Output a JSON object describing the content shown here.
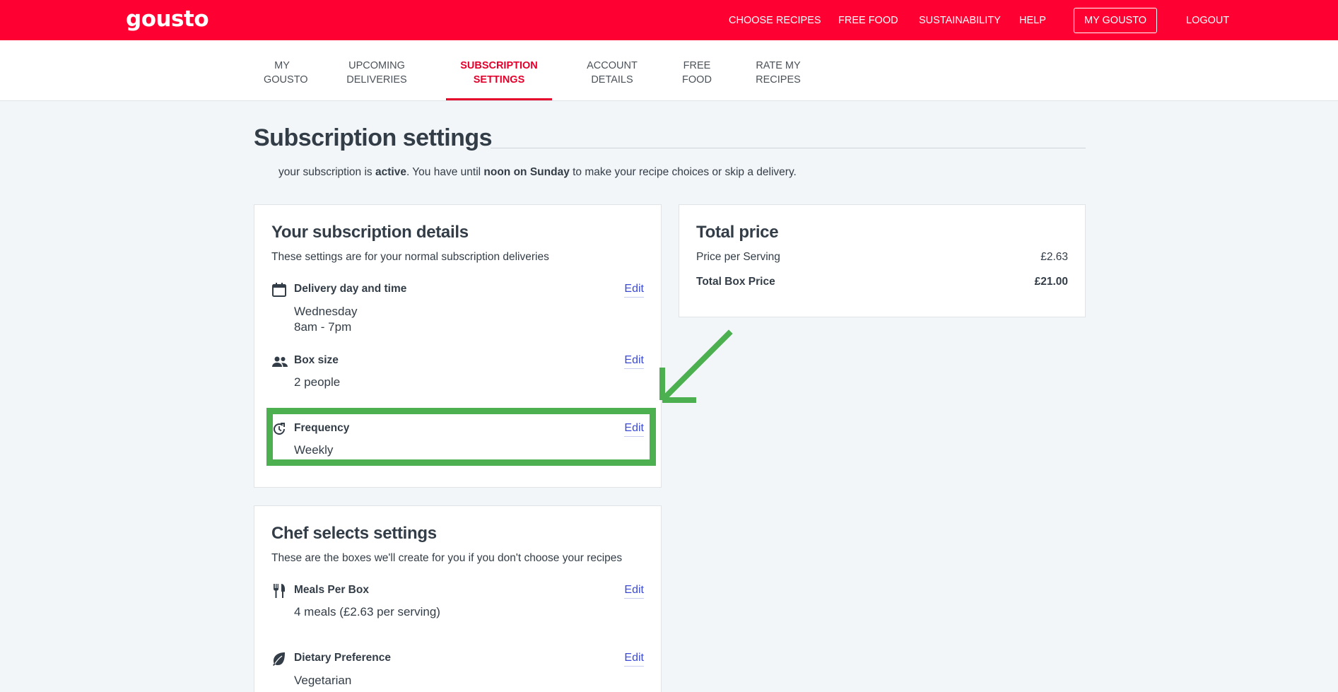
{
  "brand": {
    "logo": "gousto",
    "accent_color": "#ff0032"
  },
  "topnav": {
    "items": [
      "CHOOSE RECIPES",
      "FREE FOOD",
      "SUSTAINABILITY",
      "HELP"
    ],
    "my_gousto": "MY GOUSTO",
    "logout": "LOGOUT"
  },
  "subnav": {
    "tabs": [
      {
        "line1": "MY",
        "line2": "GOUSTO"
      },
      {
        "line1": "UPCOMING",
        "line2": "DELIVERIES"
      },
      {
        "line1": "SUBSCRIPTION",
        "line2": "SETTINGS"
      },
      {
        "line1": "ACCOUNT",
        "line2": "DETAILS"
      },
      {
        "line1": "FREE",
        "line2": "FOOD"
      },
      {
        "line1": "RATE MY",
        "line2": "RECIPES"
      }
    ],
    "active_tab": "SUBSCRIPTION SETTINGS"
  },
  "page": {
    "title": "Subscription settings",
    "status": {
      "prefix": "your subscription is ",
      "state": "active",
      "middle": ". You have until ",
      "deadline": "noon on Sunday",
      "suffix": " to make your recipe choices or skip a delivery."
    }
  },
  "subscription_details": {
    "title": "Your subscription details",
    "subtitle": "These settings are for your normal subscription deliveries",
    "delivery": {
      "label": "Delivery day and time",
      "day": "Wednesday",
      "time": "8am - 7pm",
      "edit": "Edit",
      "icon": "calendar-icon"
    },
    "box_size": {
      "label": "Box size",
      "value": "2 people",
      "edit": "Edit",
      "icon": "people-icon"
    },
    "frequency": {
      "label": "Frequency",
      "value": "Weekly",
      "edit": "Edit",
      "icon": "refresh-icon"
    }
  },
  "total_price": {
    "title": "Total price",
    "per_serving_label": "Price per Serving",
    "per_serving_value": "£2.63",
    "total_label": "Total Box Price",
    "total_value": "£21.00"
  },
  "chef_selects": {
    "title": "Chef selects settings",
    "subtitle": "These are the boxes we'll create for you if you don't choose your recipes",
    "meals": {
      "label": "Meals Per Box",
      "value": "4 meals (£2.63 per serving)",
      "edit": "Edit",
      "icon": "cutlery-icon"
    },
    "dietary": {
      "label": "Dietary Preference",
      "value": "Vegetarian",
      "edit": "Edit",
      "icon": "leaf-icon"
    }
  },
  "annotation": {
    "color": "#4caf50"
  }
}
